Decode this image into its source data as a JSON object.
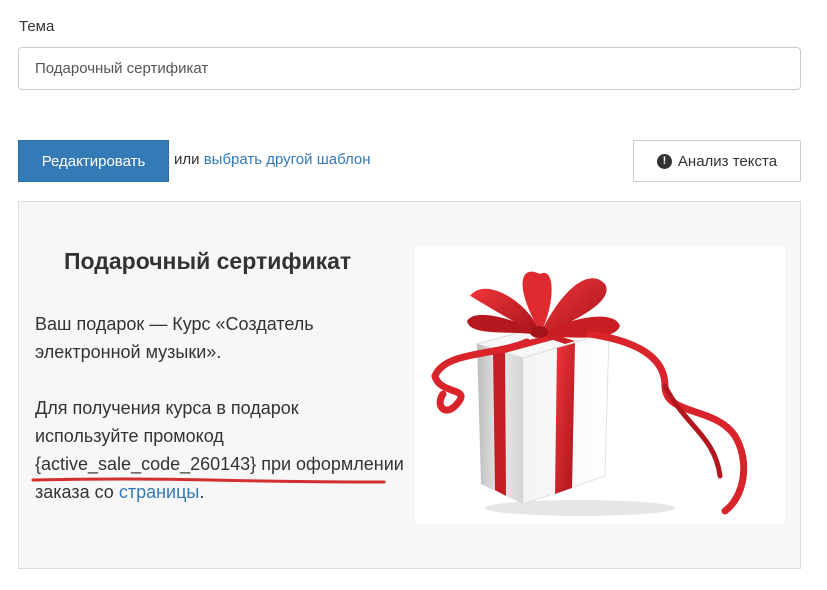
{
  "subject": {
    "label": "Тема",
    "value": "Подарочный сертификат"
  },
  "toolbar": {
    "edit_label": "Редактировать",
    "or_text": "или",
    "choose_template_link": "выбрать другой шаблон",
    "analyze_label": "Анализ текста",
    "analyze_icon": "alert-circle-icon"
  },
  "preview": {
    "title": "Подарочный сертификат",
    "line1": "Ваш подарок — Курс «Создатель электронной музыки».",
    "para2_before": "Для получения курса в подарок используйте промокод",
    "promo_code": "{active_sale_code_260143}",
    "para2_after": "при оформлении заказа со",
    "page_link": "страницы",
    "period": ".",
    "image": "gift-box-with-red-ribbon"
  },
  "colors": {
    "primary": "#337ab7",
    "ribbon": "#d9242b",
    "underline": "#d32f2f"
  }
}
